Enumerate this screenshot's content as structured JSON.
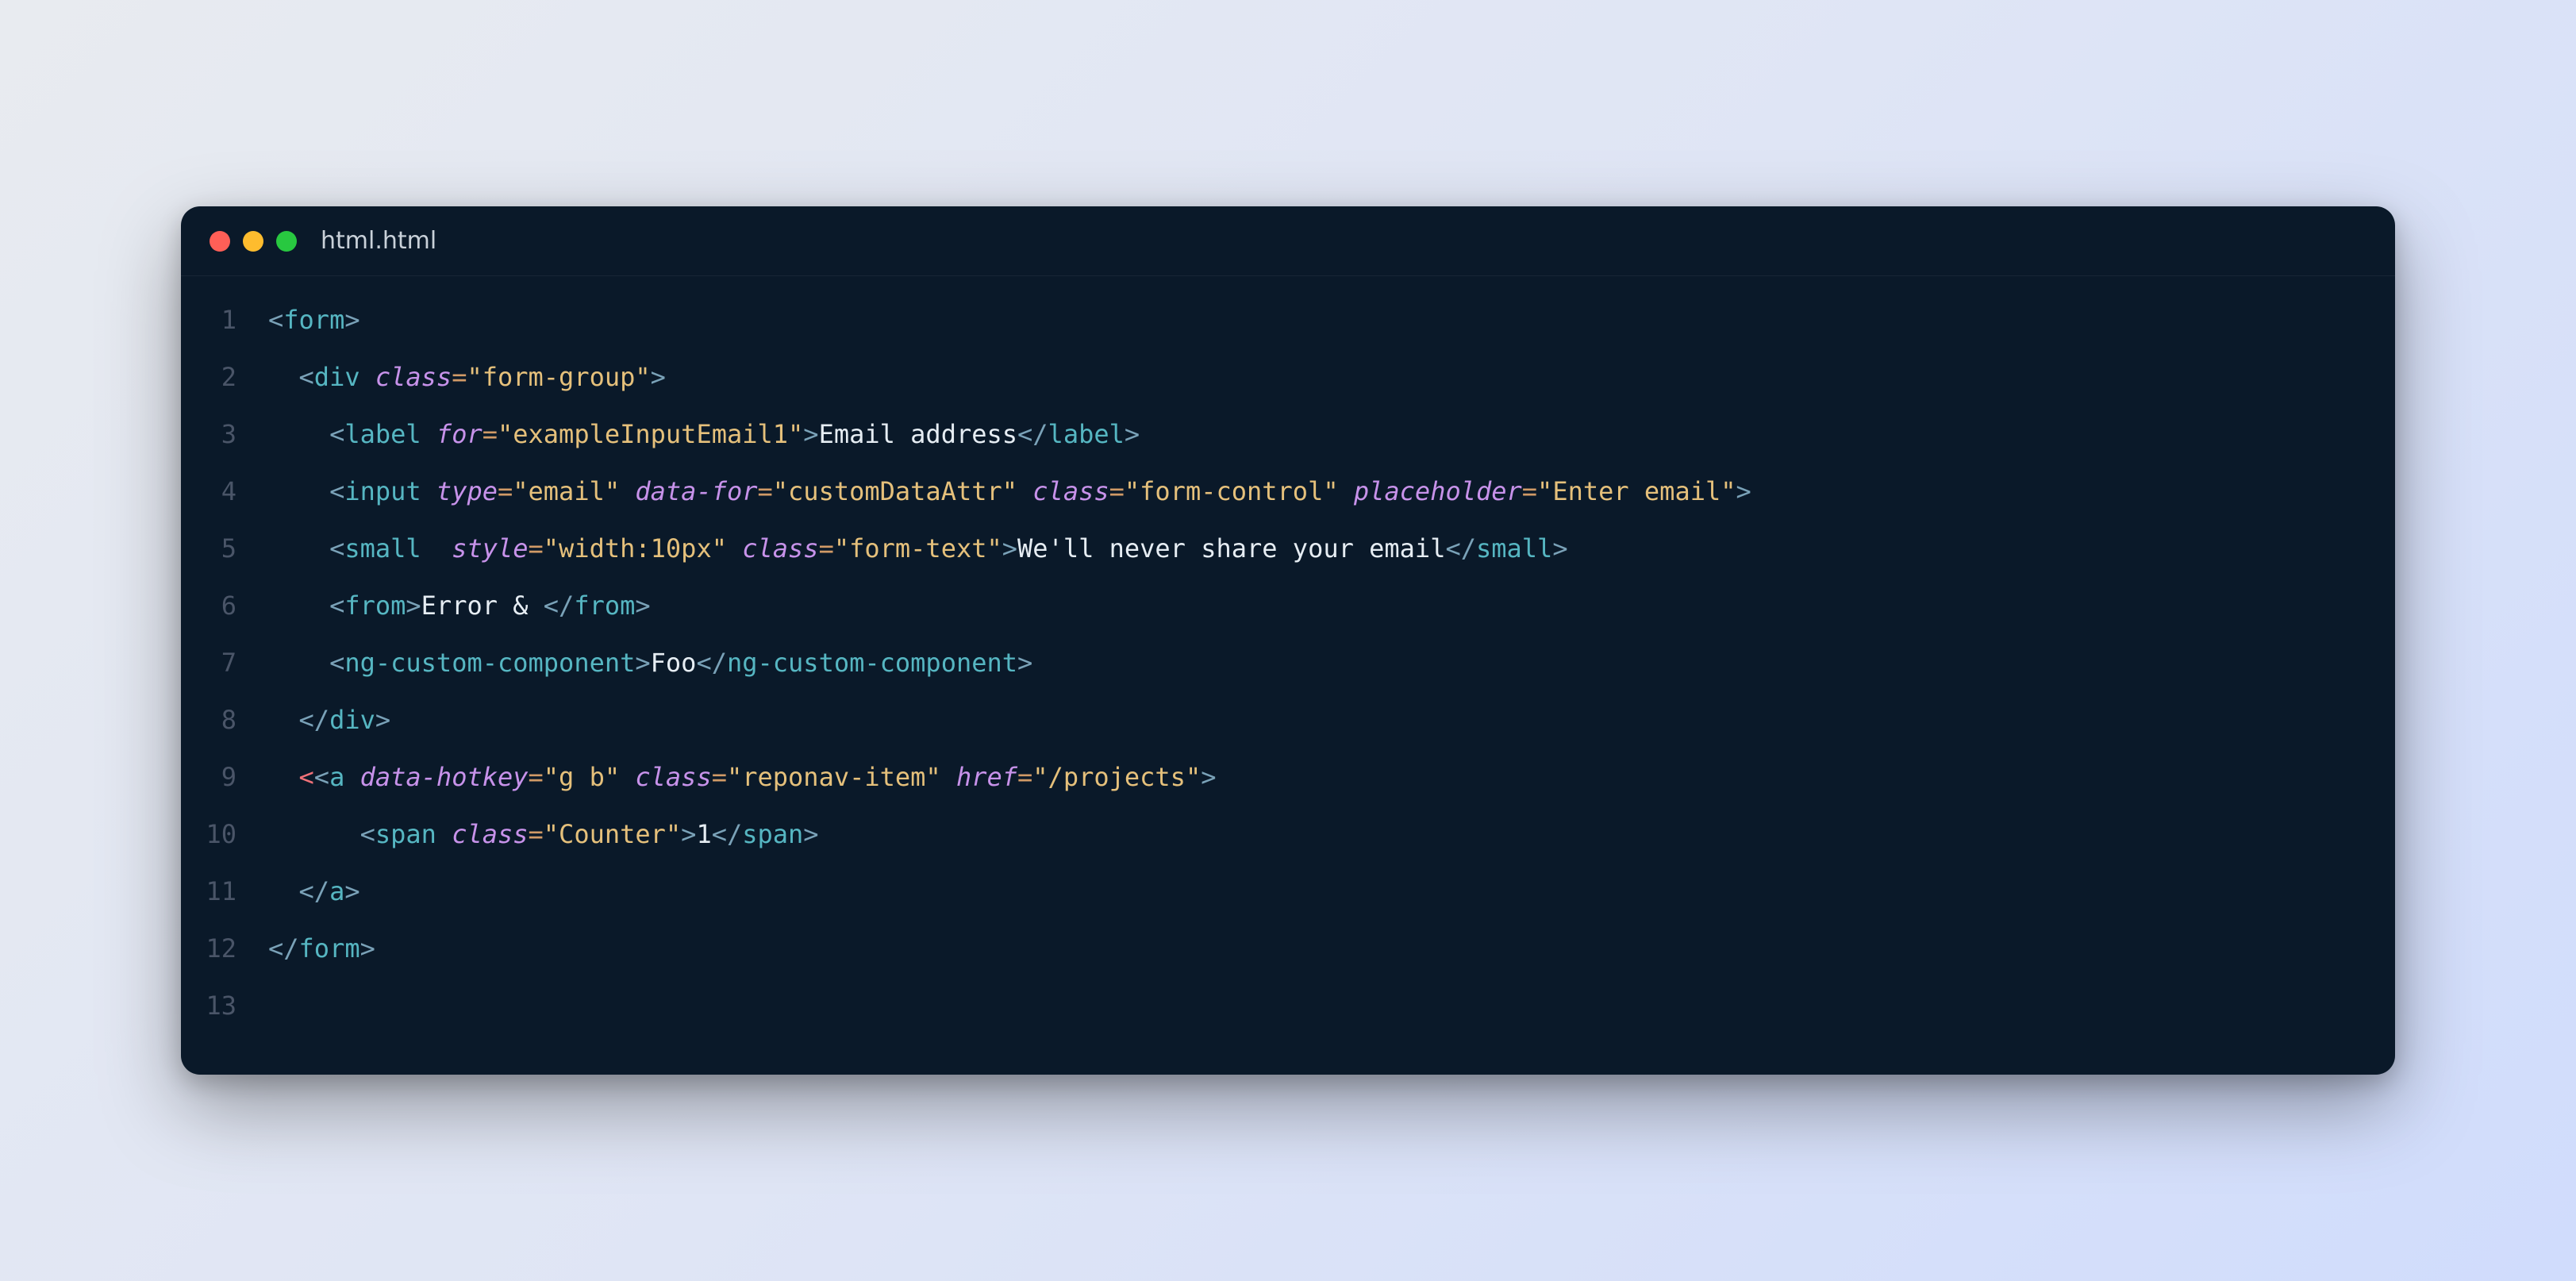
{
  "filename": "html.html",
  "lineNumbers": [
    "1",
    "2",
    "3",
    "4",
    "5",
    "6",
    "7",
    "8",
    "9",
    "10",
    "11",
    "12",
    "13"
  ],
  "code": {
    "l1": {
      "t1": "form"
    },
    "l2": {
      "t1": "div",
      "a1": "class",
      "v1": "\"form-group\""
    },
    "l3": {
      "t1": "label",
      "a1": "for",
      "v1": "\"exampleInputEmail1\"",
      "tx": "Email address",
      "t2": "label"
    },
    "l4": {
      "t1": "input",
      "a1": "type",
      "v1": "\"email\"",
      "a2": "data-for",
      "v2": "\"customDataAttr\"",
      "a3": "class",
      "v3": "\"form-control\"",
      "a4": "placeholder",
      "v4": "\"Enter email\""
    },
    "l5": {
      "t1": "small",
      "a1": "style",
      "v1": "\"width:10px\"",
      "a2": "class",
      "v2": "\"form-text\"",
      "tx": "We'll never share your email",
      "t2": "small"
    },
    "l6": {
      "t1": "from",
      "tx": "Error & ",
      "t2": "from"
    },
    "l7": {
      "t1": "ng-custom-component",
      "tx": "Foo",
      "t2": "ng-custom-component"
    },
    "l8": {
      "t1": "div"
    },
    "l9": {
      "e1": "<",
      "t1": "a",
      "a1": "data-hotkey",
      "v1": "\"g b\"",
      "a2": "class",
      "v2": "\"reponav-item\"",
      "a3": "href",
      "v3": "\"/projects\""
    },
    "l10": {
      "t1": "span",
      "a1": "class",
      "v1": "\"Counter\"",
      "tx": "1",
      "t2": "span"
    },
    "l11": {
      "t1": "a"
    },
    "l12": {
      "t1": "form"
    }
  }
}
